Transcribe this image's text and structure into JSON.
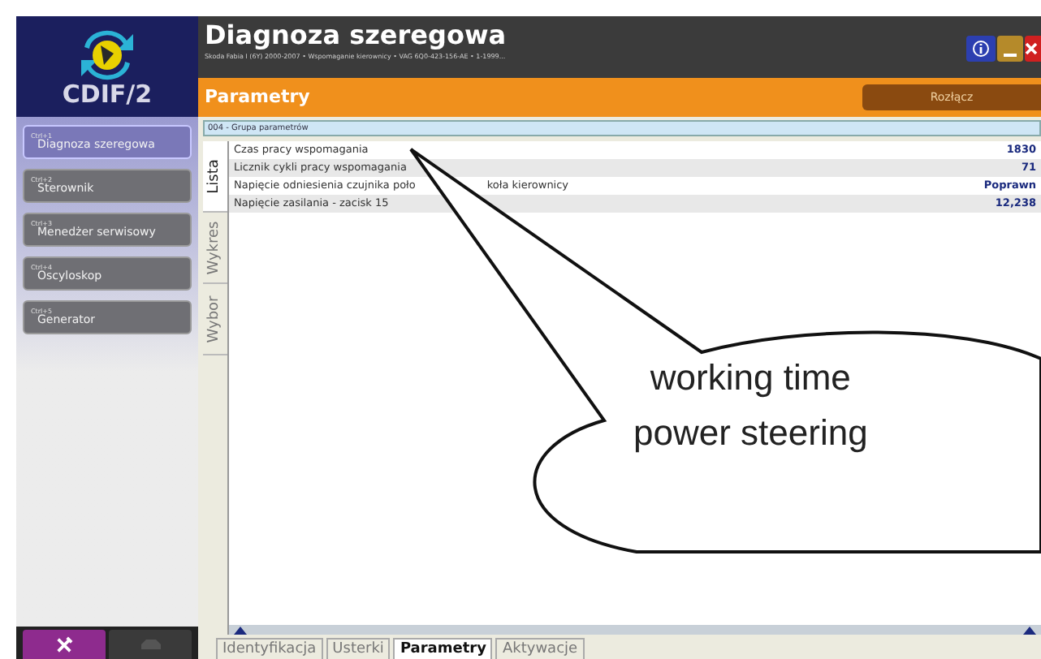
{
  "logo": {
    "text": "CDIF/2"
  },
  "header": {
    "title": "Diagnoza szeregowa",
    "subtitle": "Skoda Fabia I (6Y)  2000-2007 • Wspomaganie kierownicy • VAG 6Q0-423-156-AE • 1-1999..."
  },
  "section": {
    "title": "Parametry",
    "button": "Rozłącz"
  },
  "sidebar": {
    "items": [
      {
        "label": "Diagnoza szeregowa",
        "shortcut": "Ctrl+1",
        "selected": true
      },
      {
        "label": "Sterownik",
        "shortcut": "Ctrl+2",
        "selected": false
      },
      {
        "label": "Menedżer serwisowy",
        "shortcut": "Ctrl+3",
        "selected": false
      },
      {
        "label": "Oscyloskop",
        "shortcut": "Ctrl+4",
        "selected": false
      },
      {
        "label": "Generator",
        "shortcut": "Ctrl+5",
        "selected": false
      }
    ]
  },
  "group": {
    "title": "004 - Grupa parametrów"
  },
  "side_tabs": [
    {
      "label": "Lista",
      "selected": true
    },
    {
      "label": "Wykres",
      "selected": false
    },
    {
      "label": "Wybor",
      "selected": false
    }
  ],
  "table": {
    "rows": [
      {
        "name": "Czas pracy wspomagania",
        "value": "1830"
      },
      {
        "name": "Licznik cykli pracy wspomagania",
        "value": "71"
      },
      {
        "name": "Napięcie odniesienia czujnika poło",
        "name_after_pointer": "koła kierownicy",
        "value": "Poprawn"
      },
      {
        "name": "Napięcie zasilania - zacisk 15",
        "value": "12,238"
      }
    ]
  },
  "bottom_tabs": [
    {
      "label": "Identyfikacja",
      "selected": false
    },
    {
      "label": "Usterki",
      "selected": false
    },
    {
      "label": "Parametry",
      "selected": true
    },
    {
      "label": "Aktywacje",
      "selected": false
    }
  ],
  "callout": {
    "lines": [
      "working time",
      "power steering"
    ]
  }
}
